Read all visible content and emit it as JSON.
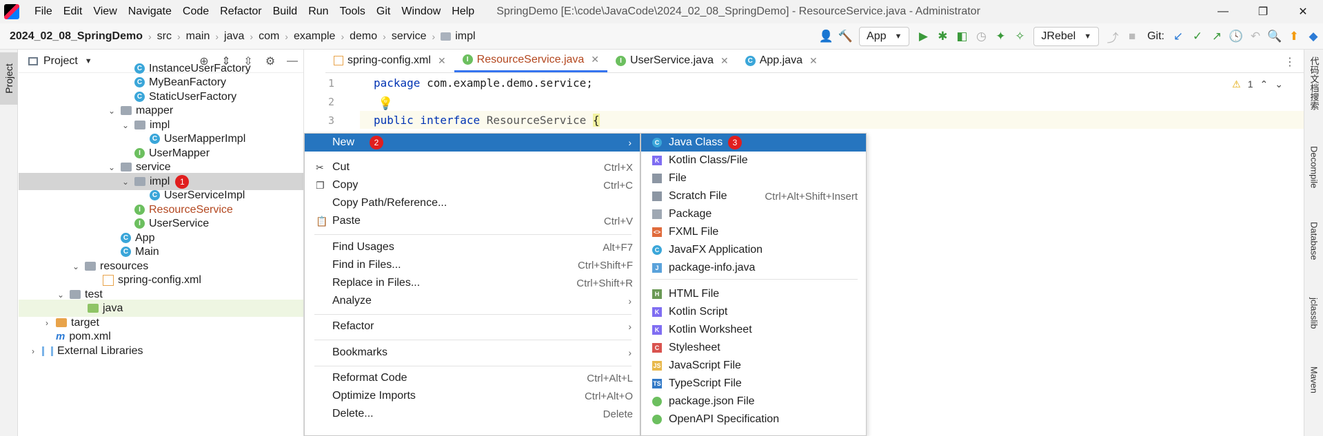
{
  "titlebar": {
    "menus": [
      "File",
      "Edit",
      "View",
      "Navigate",
      "Code",
      "Refactor",
      "Build",
      "Run",
      "Tools",
      "Git",
      "Window",
      "Help"
    ],
    "window_title": "SpringDemo [E:\\code\\JavaCode\\2024_02_08_SpringDemo] - ResourceService.java - Administrator"
  },
  "breadcrumb": [
    "2024_02_08_SpringDemo",
    "src",
    "main",
    "java",
    "com",
    "example",
    "demo",
    "service",
    "impl"
  ],
  "toolbar": {
    "run_config": "App",
    "jrebel_config": "JRebel",
    "git_label": "Git:"
  },
  "leftstrip": {
    "project_tab": "Project"
  },
  "project_panel": {
    "title": "Project",
    "tree": [
      {
        "label": "InstanceUserFactory",
        "icon": "class-icon"
      },
      {
        "label": "MyBeanFactory",
        "icon": "class-icon"
      },
      {
        "label": "StaticUserFactory",
        "icon": "class-icon"
      },
      {
        "label": "mapper",
        "icon": "package-icon"
      },
      {
        "label": "impl",
        "icon": "package-icon"
      },
      {
        "label": "UserMapperImpl",
        "icon": "class-icon"
      },
      {
        "label": "UserMapper",
        "icon": "interface-icon"
      },
      {
        "label": "service",
        "icon": "package-icon"
      },
      {
        "label": "impl",
        "icon": "package-icon",
        "badge": "1"
      },
      {
        "label": "UserServiceImpl",
        "icon": "class-icon"
      },
      {
        "label": "ResourceService",
        "icon": "interface-icon"
      },
      {
        "label": "UserService",
        "icon": "interface-icon"
      },
      {
        "label": "App",
        "icon": "class-icon"
      },
      {
        "label": "Main",
        "icon": "class-icon"
      },
      {
        "label": "resources",
        "icon": "resources-folder-icon"
      },
      {
        "label": "spring-config.xml",
        "icon": "xml-icon"
      },
      {
        "label": "test",
        "icon": "folder-icon"
      },
      {
        "label": "java",
        "icon": "test-folder-icon"
      },
      {
        "label": "target",
        "icon": "excluded-folder-icon"
      },
      {
        "label": "pom.xml",
        "icon": "maven-icon"
      },
      {
        "label": "External Libraries",
        "icon": "library-icon"
      }
    ]
  },
  "editor_tabs": [
    {
      "label": "spring-config.xml"
    },
    {
      "label": "ResourceService.java"
    },
    {
      "label": "UserService.java"
    },
    {
      "label": "App.java"
    }
  ],
  "editor": {
    "line_numbers": [
      "1",
      "2",
      "3"
    ],
    "line1_kw": "package",
    "line1_rest": " com.example.demo.service;",
    "line3_kw": "public interface",
    "line3_cls": " ResourceService ",
    "line3_brace": "{",
    "warning_count": "1"
  },
  "context_menu": {
    "new_label": "New",
    "new_badge": "2",
    "items": [
      {
        "label": "Cut",
        "shortcut": "Ctrl+X"
      },
      {
        "label": "Copy",
        "shortcut": "Ctrl+C"
      },
      {
        "label": "Copy Path/Reference...",
        "shortcut": ""
      },
      {
        "label": "Paste",
        "shortcut": "Ctrl+V"
      },
      {
        "label": "Find Usages",
        "shortcut": "Alt+F7"
      },
      {
        "label": "Find in Files...",
        "shortcut": "Ctrl+Shift+F"
      },
      {
        "label": "Replace in Files...",
        "shortcut": "Ctrl+Shift+R"
      },
      {
        "label": "Analyze",
        "shortcut": ""
      },
      {
        "label": "Refactor",
        "shortcut": ""
      },
      {
        "label": "Bookmarks",
        "shortcut": ""
      },
      {
        "label": "Reformat Code",
        "shortcut": "Ctrl+Alt+L"
      },
      {
        "label": "Optimize Imports",
        "shortcut": "Ctrl+Alt+O"
      },
      {
        "label": "Delete...",
        "shortcut": "Delete"
      }
    ]
  },
  "submenu": {
    "java_class_label": "Java Class",
    "java_class_badge": "3",
    "items": [
      {
        "label": "Kotlin Class/File",
        "shortcut": ""
      },
      {
        "label": "File",
        "shortcut": ""
      },
      {
        "label": "Scratch File",
        "shortcut": "Ctrl+Alt+Shift+Insert"
      },
      {
        "label": "Package",
        "shortcut": ""
      },
      {
        "label": "FXML File",
        "shortcut": ""
      },
      {
        "label": "JavaFX Application",
        "shortcut": ""
      },
      {
        "label": "package-info.java",
        "shortcut": ""
      },
      {
        "label": "HTML File",
        "shortcut": ""
      },
      {
        "label": "Kotlin Script",
        "shortcut": ""
      },
      {
        "label": "Kotlin Worksheet",
        "shortcut": ""
      },
      {
        "label": "Stylesheet",
        "shortcut": ""
      },
      {
        "label": "JavaScript File",
        "shortcut": ""
      },
      {
        "label": "TypeScript File",
        "shortcut": ""
      },
      {
        "label": "package.json File",
        "shortcut": ""
      },
      {
        "label": "OpenAPI Specification",
        "shortcut": ""
      }
    ]
  },
  "rightstrip": [
    "代码文档搜索",
    "Decompile",
    "Database",
    "jclasslib",
    "Maven"
  ],
  "colors": {
    "accent": "#2675bf",
    "badge": "#e01e1e",
    "interface_name": "#b3471f"
  }
}
